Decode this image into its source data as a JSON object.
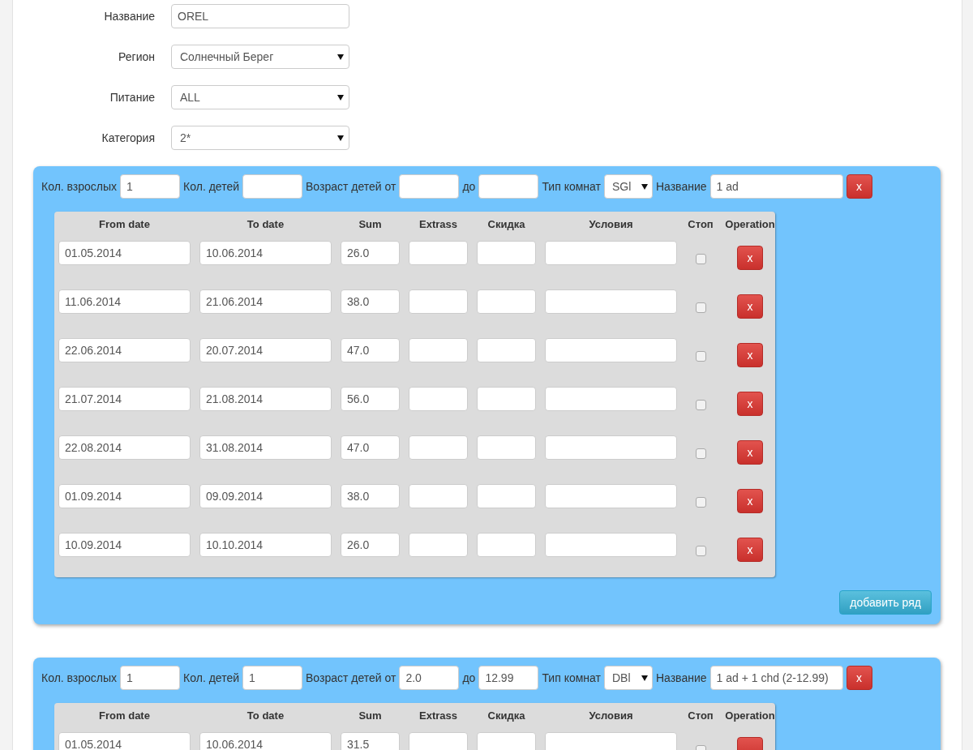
{
  "hotel_form": [
    {
      "kind": "text",
      "label": "Название",
      "value": "OREL"
    },
    {
      "kind": "select",
      "label": "Регион",
      "value": "Солнечный Берег"
    },
    {
      "kind": "select",
      "label": "Питание",
      "value": "ALL"
    },
    {
      "kind": "select",
      "label": "Категория",
      "value": "2*"
    }
  ],
  "panels": [
    {
      "adults_label": "Кол. взрослых",
      "adults": "1",
      "children_label": "Кол. детей",
      "age_from_label": "Возраст детей от",
      "age_to_label": "до",
      "room_type_label": "Тип комнат",
      "room_type": "SGl",
      "name_label": "Название",
      "name": "1 ad",
      "delete": "x",
      "columns": [
        "From date",
        "To date",
        "Sum",
        "Extrass",
        "Скидка",
        "Условия",
        "Стоп",
        "Operation"
      ],
      "rows": [
        {
          "from": "01.05.2014",
          "to": "10.06.2014",
          "sum": "26.0",
          "stop": false,
          "delete": "x"
        },
        {
          "from": "11.06.2014",
          "to": "21.06.2014",
          "sum": "38.0",
          "stop": false,
          "delete": "x"
        },
        {
          "from": "22.06.2014",
          "to": "20.07.2014",
          "sum": "47.0",
          "stop": false,
          "delete": "x"
        },
        {
          "from": "21.07.2014",
          "to": "21.08.2014",
          "sum": "56.0",
          "stop": false,
          "delete": "x"
        },
        {
          "from": "22.08.2014",
          "to": "31.08.2014",
          "sum": "47.0",
          "stop": false,
          "delete": "x"
        },
        {
          "from": "01.09.2014",
          "to": "09.09.2014",
          "sum": "38.0",
          "stop": false,
          "delete": "x"
        },
        {
          "from": "10.09.2014",
          "to": "10.10.2014",
          "sum": "26.0",
          "stop": false,
          "delete": "x"
        }
      ],
      "add_button": "добавить ряд"
    },
    {
      "adults_label": "Кол. взрослых",
      "adults": "1",
      "children_label": "Кол. детей",
      "children": "1",
      "age_from_label": "Возраст детей от",
      "age_from": "2.0",
      "age_to_label": "до",
      "age_to": "12.99",
      "room_type_label": "Тип комнат",
      "room_type": "DBl",
      "name_label": "Название",
      "name": "1 ad + 1 chd (2-12.99)",
      "delete": "x",
      "columns": [
        "From date",
        "To date",
        "Sum",
        "Extrass",
        "Скидка",
        "Условия",
        "Стоп",
        "Operation"
      ],
      "rows": [
        {
          "from": "01.05.2014",
          "to": "10.06.2014",
          "sum": "31.5",
          "stop": false
        }
      ]
    }
  ]
}
